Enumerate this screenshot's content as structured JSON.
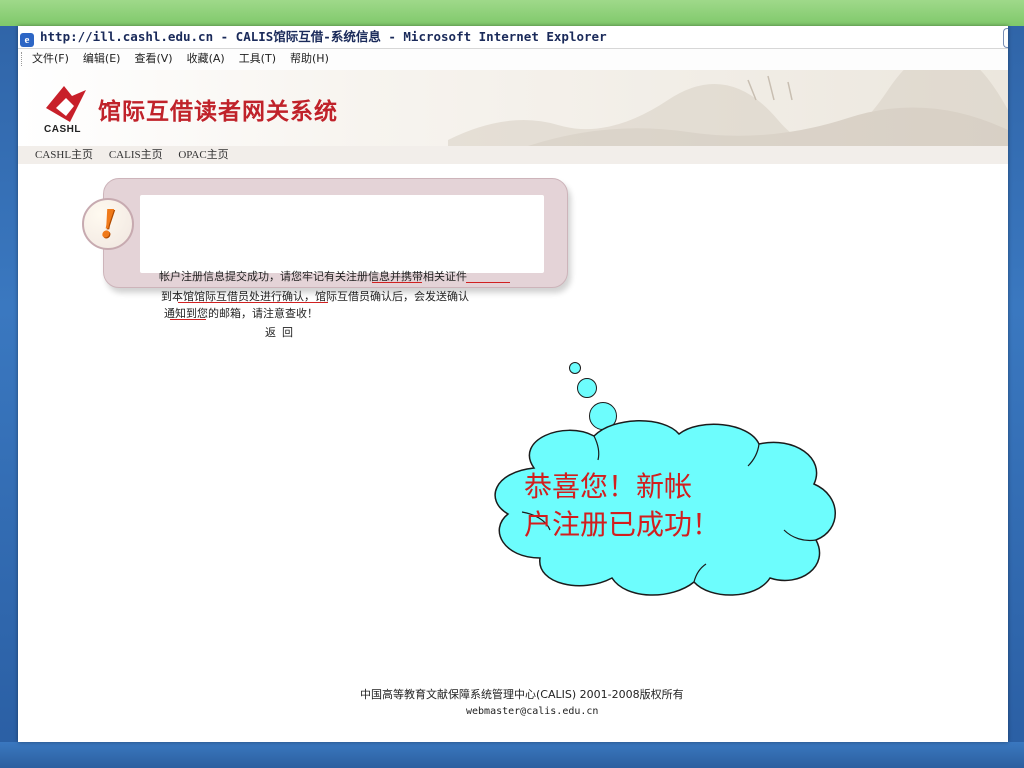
{
  "window": {
    "title": "http://ill.cashl.edu.cn - CALIS馆际互借-系统信息 - Microsoft Internet Explorer"
  },
  "menubar": {
    "items": [
      "文件(F)",
      "编辑(E)",
      "查看(V)",
      "收藏(A)",
      "工具(T)",
      "帮助(H)"
    ]
  },
  "banner": {
    "logo_text": "CASHL",
    "title": "馆际互借读者网关系统"
  },
  "nav": {
    "links": [
      "CASHL主页",
      "CALIS主页",
      "OPAC主页"
    ]
  },
  "message": {
    "line1": "帐户注册信息提交成功，请您牢记有关注册信息并携带相关证件",
    "line2": "到本馆馆际互借员处进行确认，馆际互借员确认后，会发送确认",
    "line3": "通知到您的邮箱，请注意查收！",
    "back": "返回"
  },
  "callout": {
    "line1": "恭喜您！新帐",
    "line2": "户注册已成功！"
  },
  "footer": {
    "copyright": "中国高等教育文献保障系统管理中心(CALIS) 2001-2008版权所有",
    "email": "webmaster@calis.edu.cn"
  },
  "colors": {
    "title_red": "#c0222a",
    "callout_fill": "#6dfdfd",
    "callout_text": "#d21e1e",
    "underline": "#d02020"
  }
}
